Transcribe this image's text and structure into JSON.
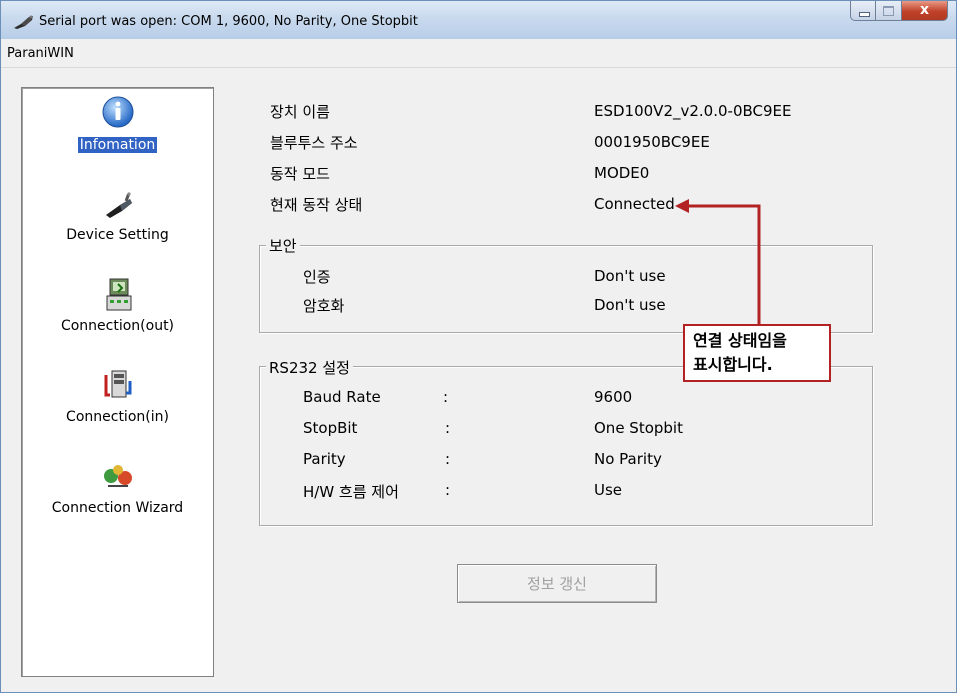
{
  "window": {
    "title": "Serial port was open: COM 1, 9600, No Parity, One Stopbit",
    "controls": {
      "minimize": "minimize",
      "maximize": "maximize",
      "close": "x"
    }
  },
  "menubar": {
    "label": "ParaniWIN"
  },
  "sidebar": {
    "items": [
      {
        "label": "Infomation",
        "icon": "info-icon",
        "selected": true
      },
      {
        "label": "Device Setting",
        "icon": "device-icon",
        "selected": false
      },
      {
        "label": "Connection(out)",
        "icon": "connection-out-icon",
        "selected": false
      },
      {
        "label": "Connection(in)",
        "icon": "connection-in-icon",
        "selected": false
      },
      {
        "label": "Connection Wizard",
        "icon": "wizard-icon",
        "selected": false
      }
    ],
    "selected_color": "#3163c5"
  },
  "info": {
    "device_name_label": "장치 이름",
    "device_name_value": "ESD100V2_v2.0.0-0BC9EE",
    "bt_address_label": "블루투스 주소",
    "bt_address_value": "0001950BC9EE",
    "mode_label": "동작 모드",
    "mode_value": "MODE0",
    "status_label": "현재 동작 상태",
    "status_value": "Connected"
  },
  "security": {
    "title": "보안",
    "auth_label": "인증",
    "auth_value": "Don't use",
    "encrypt_label": "암호화",
    "encrypt_value": "Don't use"
  },
  "rs232": {
    "title": "RS232 설정",
    "rows": [
      {
        "label": "Baud Rate",
        "sep": ":",
        "value": "9600"
      },
      {
        "label": "StopBit",
        "sep": ":",
        "value": "One Stopbit"
      },
      {
        "label": "Parity",
        "sep": ":",
        "value": "No Parity"
      },
      {
        "label": "H/W 흐름 제어",
        "sep": ":",
        "value": "Use"
      }
    ]
  },
  "refresh_button": {
    "label": "정보 갱신",
    "enabled": false
  },
  "annotation": {
    "line1": "연결 상태임을",
    "line2": "표시합니다.",
    "color": "#b32222"
  }
}
